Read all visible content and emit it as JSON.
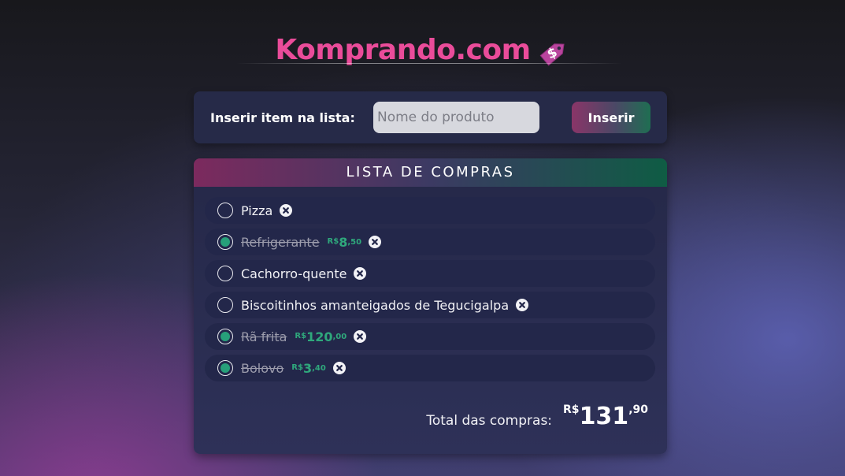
{
  "header": {
    "title": "Komprando.com",
    "tag_symbol": "$"
  },
  "insert": {
    "label": "Inserir item na lista:",
    "placeholder": "Nome do produto",
    "button_label": "Inserir"
  },
  "list": {
    "title": "LISTA DE COMPRAS",
    "items": [
      {
        "name": "Pizza",
        "checked": false,
        "price": null
      },
      {
        "name": "Refrigerante",
        "checked": true,
        "price": {
          "currency": "R$",
          "int": "8",
          "cents": ",50"
        }
      },
      {
        "name": "Cachorro-quente",
        "checked": false,
        "price": null
      },
      {
        "name": "Biscoitinhos amanteigados de Tegucigalpa",
        "checked": false,
        "price": null
      },
      {
        "name": "Rã frita",
        "checked": true,
        "price": {
          "currency": "R$",
          "int": "120",
          "cents": ",00"
        }
      },
      {
        "name": "Bolovo",
        "checked": true,
        "price": {
          "currency": "R$",
          "int": "3",
          "cents": ",40"
        }
      }
    ],
    "total_label": "Total das compras:",
    "total": {
      "currency": "R$",
      "int": "131",
      "cents": ",90"
    }
  },
  "colors": {
    "brand": "#ea4c9a",
    "price": "#2fa87c",
    "checked_radio": "#27a07a"
  },
  "icons": {
    "remove": "close-circle-icon",
    "logo": "price-tag-icon"
  }
}
